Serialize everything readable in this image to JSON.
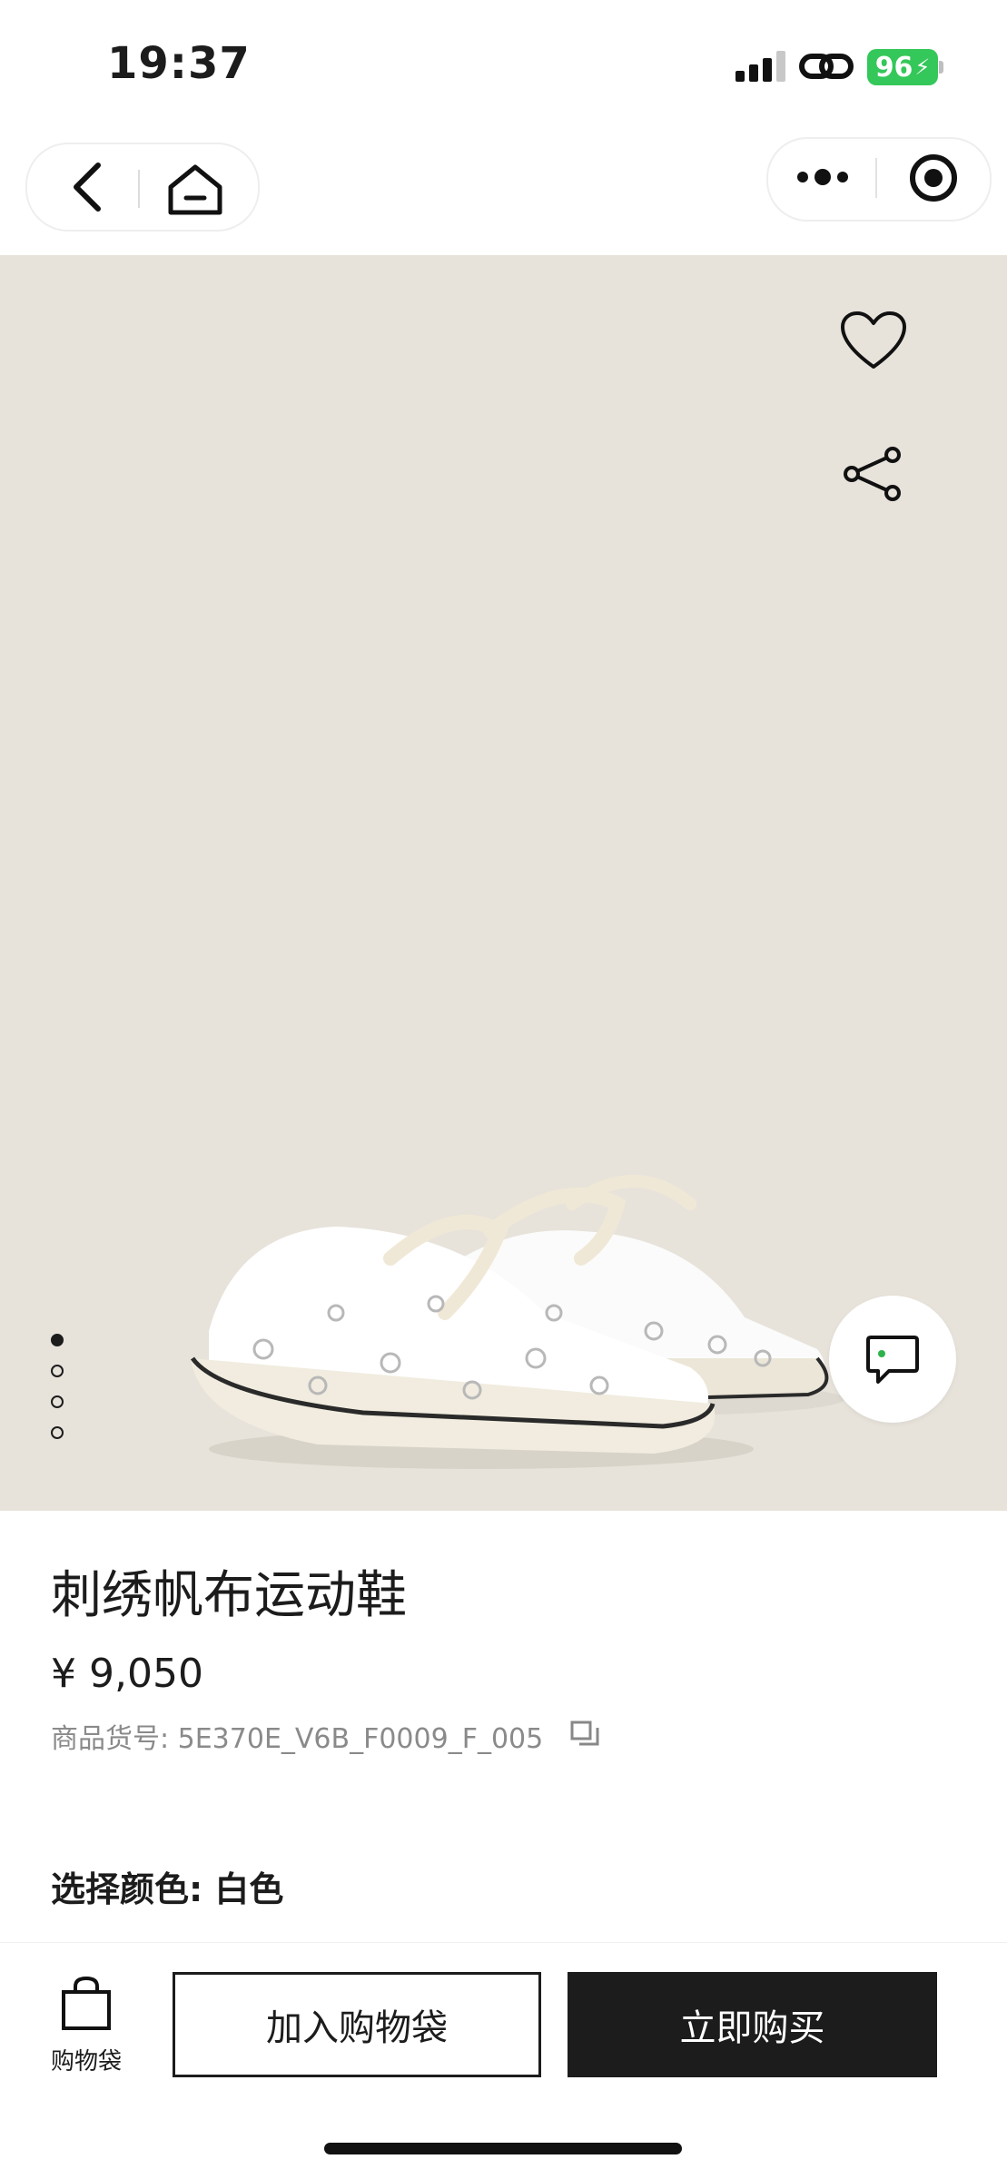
{
  "status_bar": {
    "time": "19:37",
    "battery": "96"
  },
  "nav": {
    "back_icon": "chevron-left-icon",
    "home_icon": "home-icon",
    "more_icon": "more-dots-icon",
    "close_icon": "target-icon"
  },
  "hero": {
    "background": "#e7e3db",
    "favorite_icon": "heart-outline-icon",
    "share_icon": "share-icon",
    "chat_icon": "chat-bubble-icon",
    "gallery_count": 4,
    "gallery_active_index": 0
  },
  "product": {
    "title": "刺绣帆布运动鞋",
    "price": "¥ 9,050",
    "sku": "商品货号: 5E370E_V6B_F0009_F_005",
    "color_label": "选择颜色: 白色"
  },
  "bottom_bar": {
    "bag_label": "购物袋",
    "add_to_bag": "加入购物袋",
    "buy_now": "立即购买",
    "accent": "#1c1c1c"
  }
}
